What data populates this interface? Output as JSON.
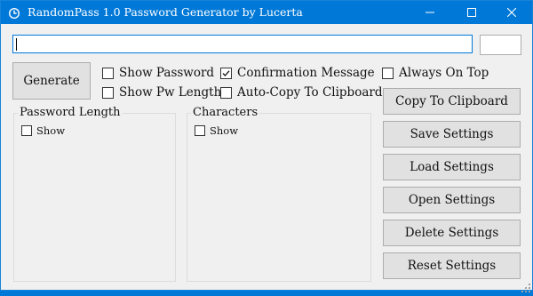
{
  "window": {
    "title": "RandomPass 1.0 Password Generator by Lucerta",
    "minimize_icon": "minimize-icon",
    "maximize_icon": "maximize-icon",
    "close_icon": "close-icon",
    "app_icon": "clock-icon"
  },
  "password_field": {
    "value": ""
  },
  "length_field": {
    "value": ""
  },
  "buttons": {
    "generate": "Generate",
    "copy": "Copy To Clipboard",
    "save": "Save Settings",
    "load": "Load Settings",
    "open": "Open Settings",
    "delete": "Delete Settings",
    "reset": "Reset Settings"
  },
  "options": {
    "show_password": {
      "label": "Show Password",
      "checked": false
    },
    "show_pw_length": {
      "label": "Show Pw Length",
      "checked": false
    },
    "confirmation_message": {
      "label": "Confirmation Message",
      "checked": true
    },
    "auto_copy": {
      "label": "Auto-Copy To Clipboard",
      "checked": false
    },
    "always_on_top": {
      "label": "Always On Top",
      "checked": false
    }
  },
  "groups": {
    "password_length": {
      "title": "Password Length",
      "show_label": "Show",
      "show_checked": false
    },
    "characters": {
      "title": "Characters",
      "show_label": "Show",
      "show_checked": false
    }
  },
  "colors": {
    "titlebar": "#0078d7",
    "window_bg": "#f0f0f0",
    "button_bg": "#e1e1e1",
    "focus_border": "#0078d7"
  }
}
